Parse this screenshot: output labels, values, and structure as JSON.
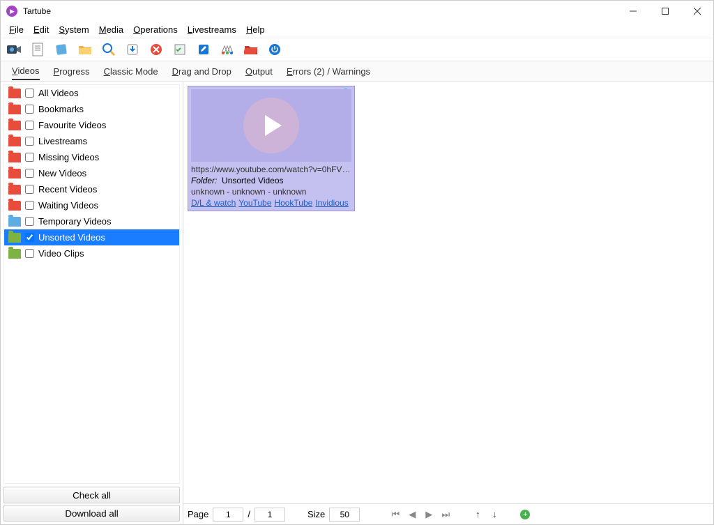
{
  "window": {
    "title": "Tartube"
  },
  "menu": [
    {
      "label": "File",
      "u": "F"
    },
    {
      "label": "Edit",
      "u": "E"
    },
    {
      "label": "System",
      "u": "S"
    },
    {
      "label": "Media",
      "u": "M"
    },
    {
      "label": "Operations",
      "u": "O"
    },
    {
      "label": "Livestreams",
      "u": "L"
    },
    {
      "label": "Help",
      "u": "H"
    }
  ],
  "tabs": [
    {
      "label": "Videos",
      "u": "V",
      "active": true
    },
    {
      "label": "Progress",
      "u": "P"
    },
    {
      "label": "Classic Mode",
      "u": "C"
    },
    {
      "label": "Drag and Drop",
      "u": "D"
    },
    {
      "label": "Output",
      "u": "O"
    },
    {
      "label": "Errors (2) / Warnings",
      "u": "E"
    }
  ],
  "sidebar": {
    "items": [
      {
        "label": "All Videos",
        "color": "red"
      },
      {
        "label": "Bookmarks",
        "color": "red"
      },
      {
        "label": "Favourite Videos",
        "color": "red"
      },
      {
        "label": "Livestreams",
        "color": "red"
      },
      {
        "label": "Missing Videos",
        "color": "red"
      },
      {
        "label": "New Videos",
        "color": "red"
      },
      {
        "label": "Recent Videos",
        "color": "red"
      },
      {
        "label": "Waiting Videos",
        "color": "red"
      },
      {
        "label": "Temporary Videos",
        "color": "blue"
      },
      {
        "label": "Unsorted Videos",
        "color": "green",
        "selected": true,
        "checked": true
      },
      {
        "label": "Video Clips",
        "color": "green"
      }
    ],
    "check_all": "Check all",
    "download_all": "Download all"
  },
  "video": {
    "url": "https://www.youtube.com/watch?v=0hFVL...",
    "folder_label": "Folder:",
    "folder_value": "Unsorted Videos",
    "meta": "unknown  -  unknown  -  unknown",
    "links": [
      "D/L & watch",
      "YouTube",
      "HookTube",
      "Invidious"
    ]
  },
  "pager": {
    "page_label": "Page",
    "page_value": "1",
    "sep": "/",
    "total": "1",
    "size_label": "Size",
    "size_value": "50"
  }
}
